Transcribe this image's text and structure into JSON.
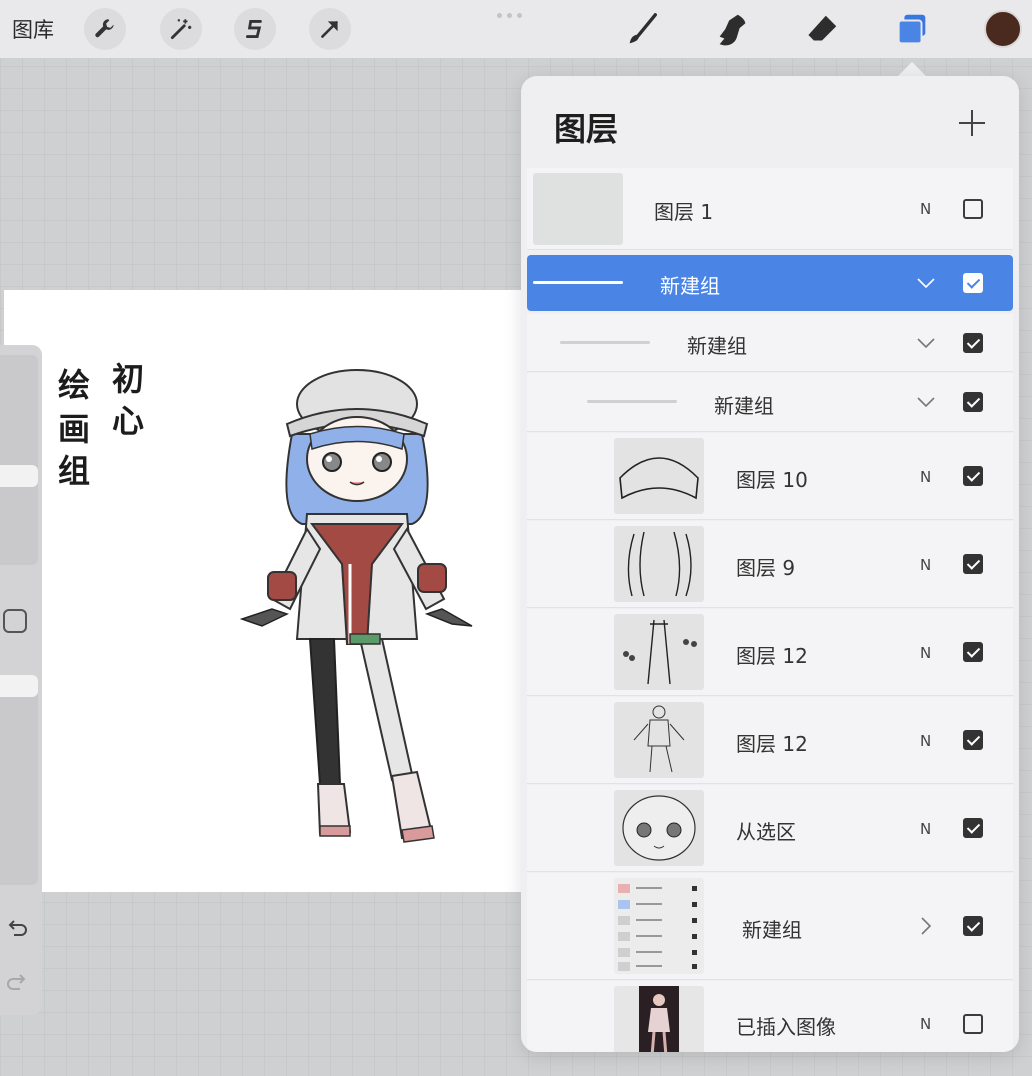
{
  "toolbar": {
    "gallery_label": "图库",
    "tools_left": [
      {
        "icon": "wrench-icon"
      },
      {
        "icon": "magic-wand-icon"
      },
      {
        "icon": "selection-icon"
      },
      {
        "icon": "move-arrow-icon"
      }
    ],
    "tools_right": [
      {
        "icon": "brush-icon"
      },
      {
        "icon": "smudge-icon"
      },
      {
        "icon": "eraser-icon"
      },
      {
        "icon": "layers-icon",
        "active": true
      }
    ],
    "color_swatch": "#4a2a1e"
  },
  "canvas": {
    "calligraphy": [
      "初",
      "心",
      "绘",
      "画",
      "组"
    ]
  },
  "layers_panel": {
    "title": "图层",
    "add_icon": "plus-icon",
    "accent": "#4a85e6",
    "layers": [
      {
        "name": "图层 1",
        "type": "layer",
        "blend": "N",
        "visible": false
      },
      {
        "name": "新建组",
        "type": "group",
        "expanded": true,
        "visible": true,
        "selected": true
      },
      {
        "name": "新建组",
        "type": "group",
        "expanded": true,
        "visible": true
      },
      {
        "name": "新建组",
        "type": "group",
        "expanded": true,
        "visible": true
      },
      {
        "name": "图层 10",
        "type": "layer",
        "blend": "N",
        "visible": true
      },
      {
        "name": "图层 9",
        "type": "layer",
        "blend": "N",
        "visible": true
      },
      {
        "name": "图层 12",
        "type": "layer",
        "blend": "N",
        "visible": true
      },
      {
        "name": "图层 12",
        "type": "layer",
        "blend": "N",
        "visible": true
      },
      {
        "name": "从选区",
        "type": "layer",
        "blend": "N",
        "visible": true
      },
      {
        "name": "新建组",
        "type": "group",
        "expanded": false,
        "visible": true
      },
      {
        "name": "已插入图像",
        "type": "layer",
        "blend": "N",
        "visible": false
      }
    ]
  }
}
